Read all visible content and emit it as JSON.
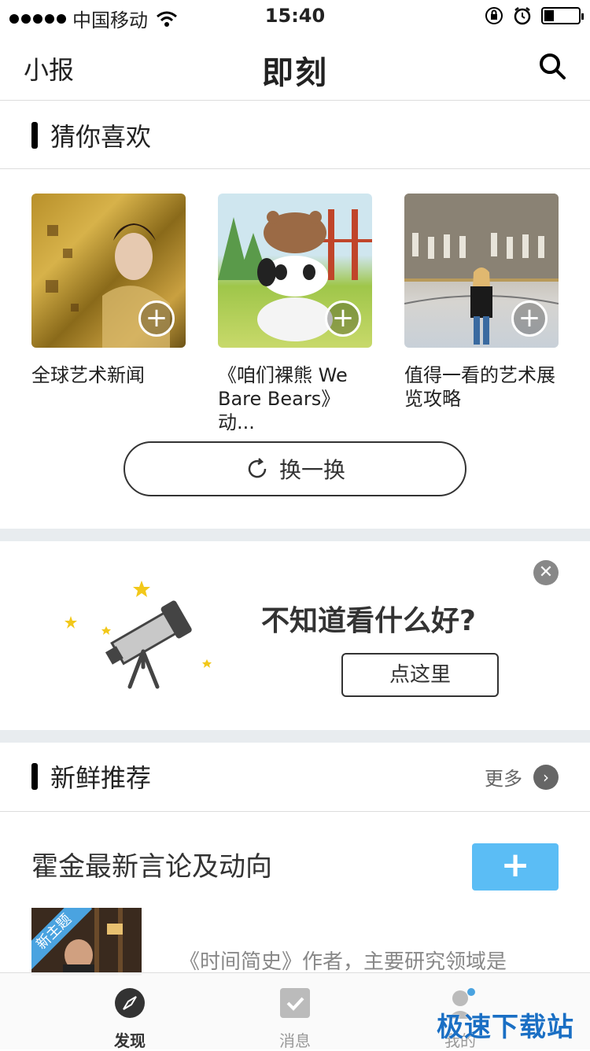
{
  "status": {
    "carrier": "中国移动",
    "time": "15:40"
  },
  "nav": {
    "left_label": "小报",
    "logo_text": "即刻"
  },
  "guess": {
    "title": "猜你喜欢",
    "cards": [
      {
        "title": "全球艺术新闻"
      },
      {
        "title": "《咱们裸熊 We Bare Bears》动..."
      },
      {
        "title": "值得一看的艺术展览攻略"
      }
    ],
    "refresh_label": "换一换"
  },
  "promo": {
    "text": "不知道看什么好?",
    "button": "点这里"
  },
  "fresh": {
    "title": "新鲜推荐",
    "more_label": "更多",
    "topic": {
      "title": "霍金最新言论及动向",
      "badge": "新主题",
      "desc": "《时间简史》作者，主要研究领域是"
    }
  },
  "tabs": [
    {
      "label": "发现",
      "icon": "compass-icon",
      "active": true
    },
    {
      "label": "消息",
      "icon": "message-check-icon",
      "active": false
    },
    {
      "label": "我的",
      "icon": "profile-icon",
      "active": false
    }
  ],
  "watermark": "极速下载站",
  "colors": {
    "accent": "#5bbdf5",
    "divider": "#e8ecef"
  }
}
